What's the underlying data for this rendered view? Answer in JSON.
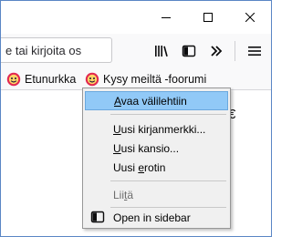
{
  "window": {
    "controls": {
      "minimize_icon": "minimize-icon",
      "maximize_icon": "maximize-icon",
      "close_icon": "close-icon"
    }
  },
  "toolbar": {
    "url_text": "e tai kirjoita os",
    "library_icon": "library-icon",
    "sidebar_icon": "sidebar-icon",
    "overflow_icon": "chevron-double-right-icon",
    "menu_icon": "hamburger-menu-icon"
  },
  "bookmarks": {
    "items": [
      {
        "label": "Etunurkka",
        "icon": "mozilla-support-icon"
      },
      {
        "label": "Kysy meiltä -foorumi",
        "icon": "mozilla-support-icon"
      }
    ]
  },
  "content": {
    "fragment": "€"
  },
  "context_menu": {
    "items": [
      {
        "label": "Avaa välilehtiin",
        "accesskey": "A",
        "rest": "vaa välilehtiin",
        "highlighted": true
      },
      {
        "label": "Uusi kirjanmerkki...",
        "accesskey": "U",
        "rest": "usi kirjanmerkki..."
      },
      {
        "label": "Uusi kansio...",
        "accesskey": "U",
        "rest": "usi kansio..."
      },
      {
        "label": "Uusi erotin",
        "pre": "Uusi ",
        "accesskey": "e",
        "rest": "rotin"
      },
      {
        "label": "Liitä",
        "pre": "Lii",
        "accesskey": "t",
        "rest": "ä",
        "disabled": true
      },
      {
        "label": "Open in sidebar",
        "icon": "sidebar-icon"
      }
    ]
  },
  "colors": {
    "window_border": "#5a86c5",
    "toolbar_bg": "#f9f9fa",
    "menu_bg": "#f0f0f0",
    "menu_highlight": "#91c9f7",
    "bookmark_icon_red": "#e22850",
    "bookmark_icon_yellow": "#ffd567"
  }
}
